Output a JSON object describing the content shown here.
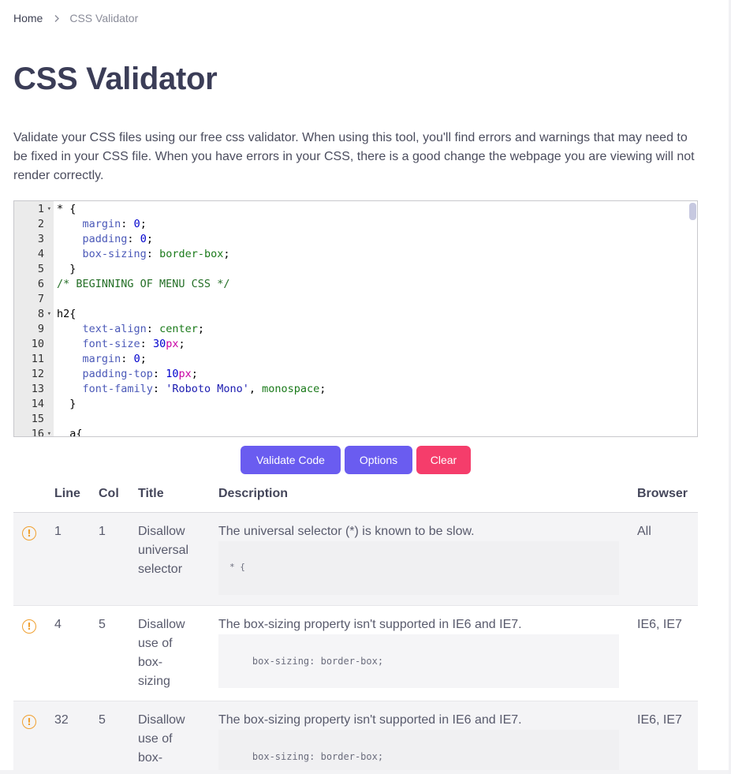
{
  "breadcrumb": {
    "home": "Home",
    "current": "CSS Validator"
  },
  "page": {
    "title": "CSS Validator",
    "intro": "Validate your CSS files using our free css validator. When using this tool, you'll find errors and warnings that may need to be fixed in your CSS file. When you have errors in your CSS, there is a good change the webpage you are viewing will not render correctly."
  },
  "editor": {
    "lines": [
      {
        "n": "1",
        "fold": true,
        "tokens": [
          [
            "",
            "* {"
          ]
        ]
      },
      {
        "n": "2",
        "fold": false,
        "tokens": [
          [
            "",
            "    "
          ],
          [
            "prop",
            "margin"
          ],
          [
            "",
            ": "
          ],
          [
            "num",
            "0"
          ],
          [
            "",
            ";"
          ]
        ]
      },
      {
        "n": "3",
        "fold": false,
        "tokens": [
          [
            "",
            "    "
          ],
          [
            "prop",
            "padding"
          ],
          [
            "",
            ": "
          ],
          [
            "num",
            "0"
          ],
          [
            "",
            ";"
          ]
        ]
      },
      {
        "n": "4",
        "fold": false,
        "tokens": [
          [
            "",
            "    "
          ],
          [
            "prop",
            "box-sizing"
          ],
          [
            "",
            ": "
          ],
          [
            "val",
            "border-box"
          ],
          [
            "",
            ";"
          ]
        ]
      },
      {
        "n": "5",
        "fold": false,
        "tokens": [
          [
            "",
            "  }"
          ]
        ]
      },
      {
        "n": "6",
        "fold": false,
        "tokens": [
          [
            "cmt",
            "/* BEGINNING OF MENU CSS */"
          ]
        ]
      },
      {
        "n": "7",
        "fold": false,
        "tokens": []
      },
      {
        "n": "8",
        "fold": true,
        "tokens": [
          [
            "",
            "h2{"
          ]
        ]
      },
      {
        "n": "9",
        "fold": false,
        "tokens": [
          [
            "",
            "    "
          ],
          [
            "prop",
            "text-align"
          ],
          [
            "",
            ": "
          ],
          [
            "val",
            "center"
          ],
          [
            "",
            ";"
          ]
        ]
      },
      {
        "n": "10",
        "fold": false,
        "tokens": [
          [
            "",
            "    "
          ],
          [
            "prop",
            "font-size"
          ],
          [
            "",
            ": "
          ],
          [
            "num",
            "30"
          ],
          [
            "unit",
            "px"
          ],
          [
            "",
            ";"
          ]
        ]
      },
      {
        "n": "11",
        "fold": false,
        "tokens": [
          [
            "",
            "    "
          ],
          [
            "prop",
            "margin"
          ],
          [
            "",
            ": "
          ],
          [
            "num",
            "0"
          ],
          [
            "",
            ";"
          ]
        ]
      },
      {
        "n": "12",
        "fold": false,
        "tokens": [
          [
            "",
            "    "
          ],
          [
            "prop",
            "padding-top"
          ],
          [
            "",
            ": "
          ],
          [
            "num",
            "10"
          ],
          [
            "unit",
            "px"
          ],
          [
            "",
            ";"
          ]
        ]
      },
      {
        "n": "13",
        "fold": false,
        "tokens": [
          [
            "",
            "    "
          ],
          [
            "prop",
            "font-family"
          ],
          [
            "",
            ": "
          ],
          [
            "str",
            "'Roboto Mono'"
          ],
          [
            "",
            ", "
          ],
          [
            "val",
            "monospace"
          ],
          [
            "",
            ";"
          ]
        ]
      },
      {
        "n": "14",
        "fold": false,
        "tokens": [
          [
            "",
            "  }"
          ]
        ]
      },
      {
        "n": "15",
        "fold": false,
        "tokens": []
      },
      {
        "n": "16",
        "fold": true,
        "tokens": [
          [
            "",
            "  a{"
          ]
        ]
      }
    ]
  },
  "actions": {
    "validate": "Validate Code",
    "options": "Options",
    "clear": "Clear"
  },
  "results": {
    "headers": {
      "line": "Line",
      "col": "Col",
      "title": "Title",
      "description": "Description",
      "browser": "Browser"
    },
    "rows": [
      {
        "line": "1",
        "col": "1",
        "title_lines": [
          "Disallow",
          "universal",
          "selector"
        ],
        "description": "The universal selector (*) is known to be slow.",
        "snippet": "* {",
        "browser": "All"
      },
      {
        "line": "4",
        "col": "5",
        "title_lines": [
          "Disallow",
          "use of",
          "box-",
          "sizing"
        ],
        "description": "The box-sizing property isn't supported in IE6 and IE7.",
        "snippet": "    box-sizing: border-box;",
        "browser": "IE6, IE7"
      },
      {
        "line": "32",
        "col": "5",
        "title_lines": [
          "Disallow",
          "use of",
          "box-"
        ],
        "description": "The box-sizing property isn't supported in IE6 and IE7.",
        "snippet": "    box-sizing: border-box;",
        "browser": "IE6, IE7"
      }
    ]
  },
  "icons": {
    "warning": "warning-circle-icon",
    "separator": "chevron-right-icon"
  },
  "colors": {
    "primary": "#6a5cf0",
    "danger": "#f53d6b",
    "warning": "#f0a030",
    "title": "#3b3d57"
  }
}
